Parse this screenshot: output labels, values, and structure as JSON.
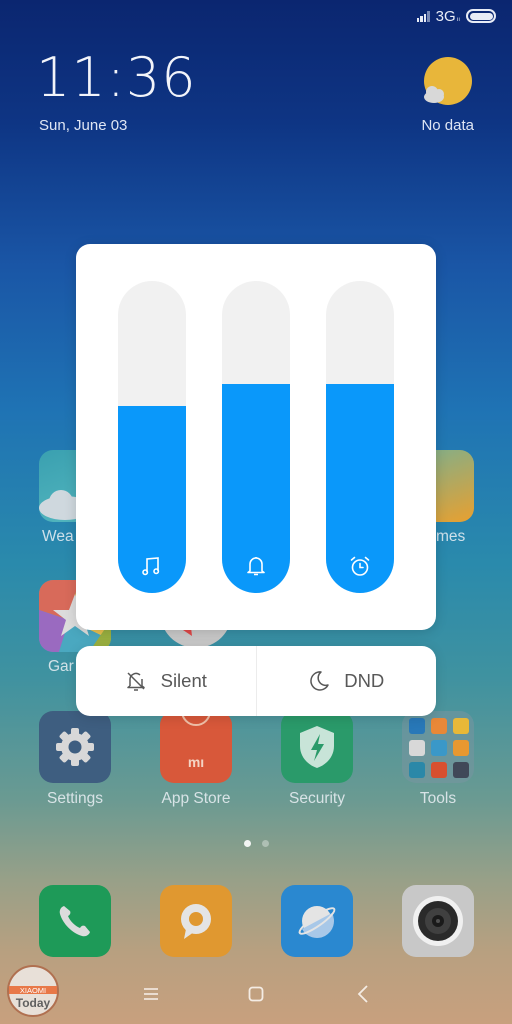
{
  "status_bar": {
    "network": "3G",
    "network_sub": "ıı",
    "signal_icon": "signal-bars-icon",
    "battery_icon": "battery-icon"
  },
  "clock": {
    "time": "11:36",
    "date": "Sun, June 03"
  },
  "weather": {
    "icon": "sun-cloud-icon",
    "label": "No data"
  },
  "home_apps": [
    {
      "label": "Wea",
      "icon": "weather-app-icon"
    },
    {
      "label": "mes",
      "icon": "themes-app-icon"
    },
    {
      "label": "Gar",
      "icon": "games-app-icon"
    },
    {
      "label": "Settings",
      "icon": "gear-icon"
    },
    {
      "label": "App Store",
      "icon": "mi-store-icon"
    },
    {
      "label": "Security",
      "icon": "shield-bolt-icon"
    },
    {
      "label": "Tools",
      "icon": "folder-icon"
    }
  ],
  "volume_panel": {
    "sliders": [
      {
        "name": "media",
        "icon": "music-note-icon",
        "level_percent": 60
      },
      {
        "name": "ringer",
        "icon": "bell-icon",
        "level_percent": 67
      },
      {
        "name": "alarm",
        "icon": "alarm-clock-icon",
        "level_percent": 67
      }
    ],
    "accent_color": "#0a98fa",
    "track_color": "#f1f1f1"
  },
  "mode_buttons": {
    "silent": {
      "label": "Silent",
      "icon": "bell-off-icon"
    },
    "dnd": {
      "label": "DND",
      "icon": "moon-icon"
    }
  },
  "page_indicator": {
    "pages": 2,
    "current": 1
  },
  "dock": [
    {
      "name": "phone",
      "icon": "phone-icon"
    },
    {
      "name": "messages",
      "icon": "chat-bubble-icon"
    },
    {
      "name": "browser",
      "icon": "planet-icon"
    },
    {
      "name": "camera",
      "icon": "camera-lens-icon"
    }
  ],
  "nav_bar": {
    "menu": "menu-icon",
    "home": "home-square-icon",
    "back": "back-chevron-icon"
  },
  "watermark": {
    "line1": "XIAOMI",
    "line2": "Today"
  }
}
